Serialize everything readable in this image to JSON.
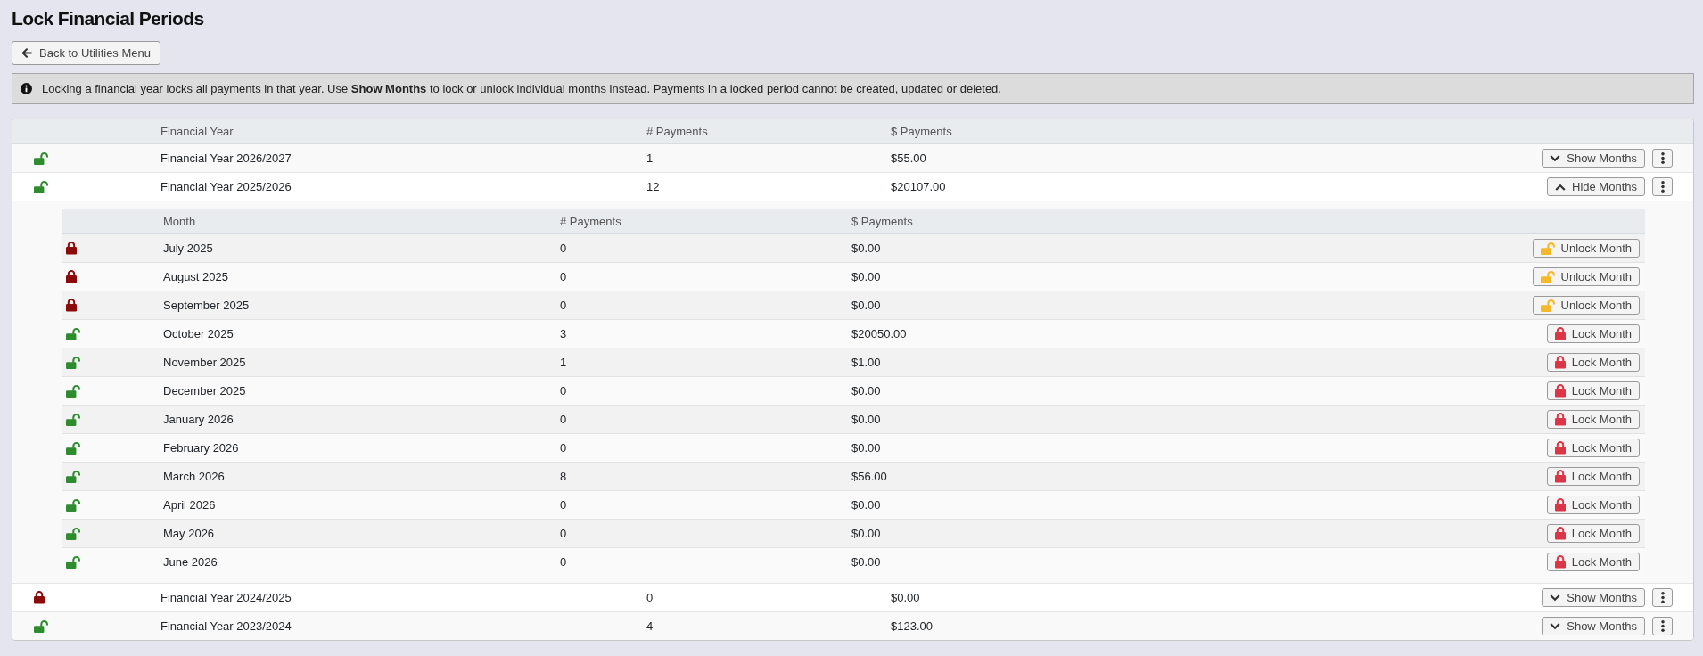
{
  "page": {
    "title": "Lock Financial Periods"
  },
  "back_button": {
    "label": "Back to Utilities Menu"
  },
  "notice": {
    "text": "Locking a financial year locks all payments in that year. Use **Show Months** to lock or unlock individual months instead. Payments in a locked period cannot be created, updated or deleted."
  },
  "years": {
    "columns": [
      "Financial Year",
      "# Payments",
      "$ Payments"
    ],
    "rows": [
      {
        "name": "Financial Year 2026/2027",
        "payments_count": "1",
        "payments_total": "$55.00",
        "locked": false,
        "expanded": false,
        "toggle_label": "Show Months"
      },
      {
        "name": "Financial Year 2025/2026",
        "payments_count": "12",
        "payments_total": "$20107.00",
        "locked": false,
        "expanded": true,
        "toggle_label": "Hide Months",
        "months": {
          "columns": [
            "Month",
            "# Payments",
            "$ Payments"
          ],
          "rows": [
            {
              "name": "July 2025",
              "payments_count": "0",
              "payments_total": "$0.00",
              "locked": true,
              "action_label": "Unlock Month"
            },
            {
              "name": "August 2025",
              "payments_count": "0",
              "payments_total": "$0.00",
              "locked": true,
              "action_label": "Unlock Month"
            },
            {
              "name": "September 2025",
              "payments_count": "0",
              "payments_total": "$0.00",
              "locked": true,
              "action_label": "Unlock Month"
            },
            {
              "name": "October 2025",
              "payments_count": "3",
              "payments_total": "$20050.00",
              "locked": false,
              "action_label": "Lock Month"
            },
            {
              "name": "November 2025",
              "payments_count": "1",
              "payments_total": "$1.00",
              "locked": false,
              "action_label": "Lock Month"
            },
            {
              "name": "December 2025",
              "payments_count": "0",
              "payments_total": "$0.00",
              "locked": false,
              "action_label": "Lock Month"
            },
            {
              "name": "January 2026",
              "payments_count": "0",
              "payments_total": "$0.00",
              "locked": false,
              "action_label": "Lock Month"
            },
            {
              "name": "February 2026",
              "payments_count": "0",
              "payments_total": "$0.00",
              "locked": false,
              "action_label": "Lock Month"
            },
            {
              "name": "March 2026",
              "payments_count": "8",
              "payments_total": "$56.00",
              "locked": false,
              "action_label": "Lock Month"
            },
            {
              "name": "April 2026",
              "payments_count": "0",
              "payments_total": "$0.00",
              "locked": false,
              "action_label": "Lock Month"
            },
            {
              "name": "May 2026",
              "payments_count": "0",
              "payments_total": "$0.00",
              "locked": false,
              "action_label": "Lock Month"
            },
            {
              "name": "June 2026",
              "payments_count": "0",
              "payments_total": "$0.00",
              "locked": false,
              "action_label": "Lock Month"
            }
          ]
        }
      },
      {
        "name": "Financial Year 2024/2025",
        "payments_count": "0",
        "payments_total": "$0.00",
        "locked": true,
        "expanded": false,
        "toggle_label": "Show Months"
      },
      {
        "name": "Financial Year 2023/2024",
        "payments_count": "4",
        "payments_total": "$123.00",
        "locked": false,
        "expanded": false,
        "toggle_label": "Show Months"
      }
    ]
  }
}
